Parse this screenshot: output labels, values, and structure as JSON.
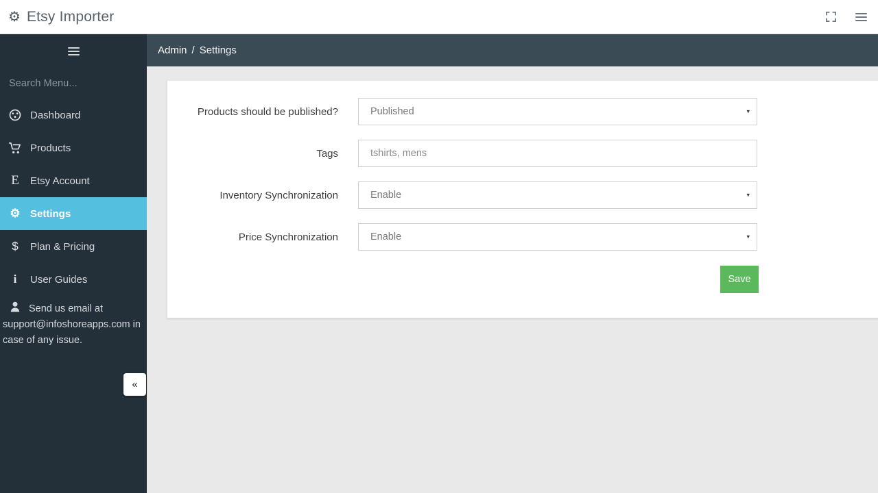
{
  "topbar": {
    "brand_icon": "gear-icon",
    "brand_title": "Etsy Importer",
    "fullscreen_icon": "fullscreen-expand-icon",
    "menu_icon": "hamburger-menu-icon"
  },
  "sidebar": {
    "toggle_icon": "hamburger-menu-icon",
    "search_placeholder": "Search Menu...",
    "items": [
      {
        "label": "Dashboard",
        "icon": "dashboard-speedometer-icon",
        "glyph": "◔",
        "active": false
      },
      {
        "label": "Products",
        "icon": "shopping-cart-icon",
        "glyph": "🛒",
        "active": false
      },
      {
        "label": "Etsy Account",
        "icon": "etsy-letter-e-icon",
        "glyph": "E",
        "active": false
      },
      {
        "label": "Settings",
        "icon": "gear-icon",
        "glyph": "⚙",
        "active": true
      },
      {
        "label": "Plan & Pricing",
        "icon": "dollar-sign-icon",
        "glyph": "$",
        "active": false
      },
      {
        "label": "User Guides",
        "icon": "info-icon",
        "glyph": "i",
        "active": false
      }
    ],
    "support": {
      "icon": "user-person-icon",
      "line1": "Send us email at",
      "line2": "support@infoshoreapps.com in",
      "line3": "case of any issue."
    },
    "collapse_label": "«",
    "active_color": "#55bfe0",
    "background_color": "#232f39"
  },
  "breadcrumb": {
    "parent": "Admin",
    "separator": "/",
    "current": "Settings"
  },
  "settings_form": {
    "rows": [
      {
        "label": "Products should be published?",
        "type": "select",
        "value": "Published",
        "caret": "▾"
      },
      {
        "label": "Tags",
        "type": "text",
        "placeholder": "tshirts, mens",
        "value": ""
      },
      {
        "label": "Inventory Synchronization",
        "type": "select",
        "value": "Enable",
        "caret": "▾"
      },
      {
        "label": "Price Synchronization",
        "type": "select",
        "value": "Enable",
        "caret": "▾"
      }
    ],
    "save_label": "Save",
    "save_color": "#5cb85c"
  }
}
